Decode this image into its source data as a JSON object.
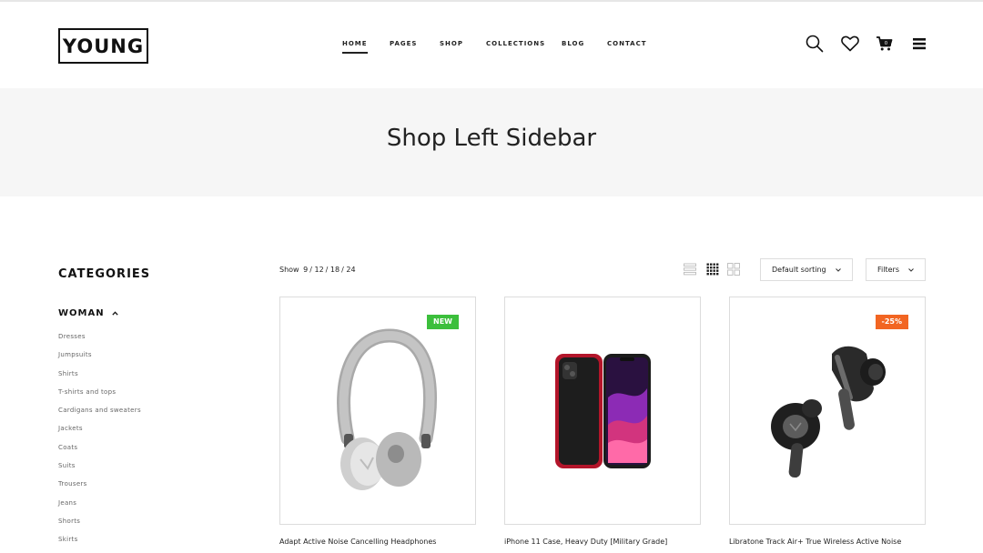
{
  "brand": {
    "logo_text": "YOUNG"
  },
  "nav": {
    "items": [
      {
        "label": "HOME",
        "active": true
      },
      {
        "label": "PAGES"
      },
      {
        "label": "SHOP"
      },
      {
        "label": "COLLECTIONS"
      },
      {
        "label": "BLOG"
      },
      {
        "label": "CONTACT"
      }
    ]
  },
  "header_icons": [
    "search-icon",
    "heart-icon",
    "cart-icon",
    "menu-icon"
  ],
  "page": {
    "title": "Shop Left Sidebar"
  },
  "sidebar": {
    "title": "CATEGORIES",
    "section": {
      "label": "WOMAN",
      "expanded": true
    },
    "items": [
      "Dresses",
      "Jumpsuits",
      "Shirts",
      "T-shirts and tops",
      "Cardigans and sweaters",
      "Jackets",
      "Coats",
      "Suits",
      "Trousers",
      "Jeans",
      "Shorts",
      "Skirts"
    ]
  },
  "toolbar": {
    "show_label": "Show",
    "show_options": [
      "9",
      "12",
      "18",
      "24"
    ],
    "sorting": {
      "selected": "Default sorting"
    },
    "filters_label": "Filters",
    "view_modes": [
      "list-view-icon",
      "grid-4-icon",
      "grid-2-icon"
    ]
  },
  "products": [
    {
      "name": "Adapt Active Noise Cancelling Headphones",
      "badge": "NEW",
      "badge_color": "#3cbf3c"
    },
    {
      "name": "iPhone 11 Case, Heavy Duty [Military Grade]",
      "badge": "",
      "badge_color": ""
    },
    {
      "name": "Libratone Track Air+ True Wireless Active Noise",
      "badge": "-25%",
      "badge_color": "#f26522"
    }
  ]
}
